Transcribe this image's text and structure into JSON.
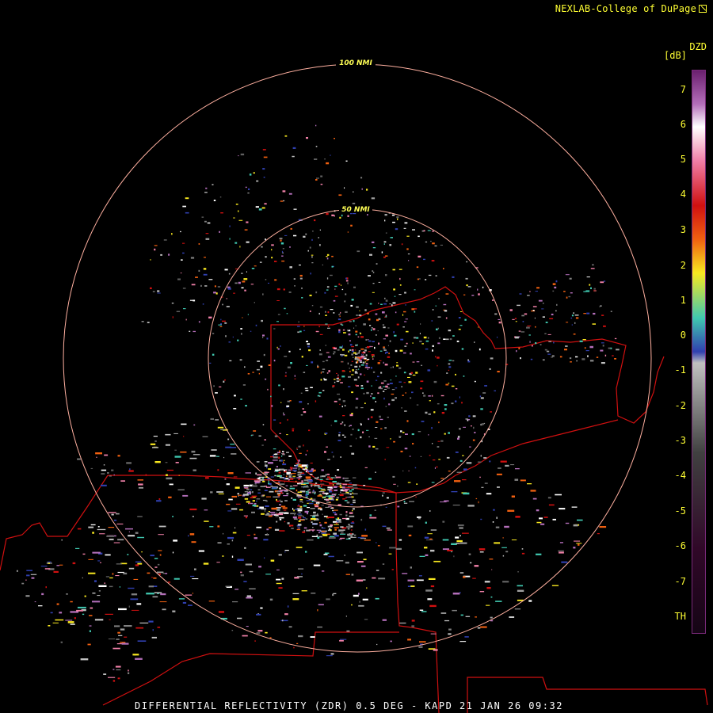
{
  "header": {
    "credit": "NEXLAB-College of DuPage",
    "credit_icon": "external-link-icon"
  },
  "colorbar": {
    "product_code": "DZD",
    "unit": "[dB]",
    "tick_labels": [
      "7",
      "6",
      "5",
      "4",
      "3",
      "2",
      "1",
      "0",
      "-1",
      "-2",
      "-3",
      "-4",
      "-5",
      "-6",
      "-7",
      "TH"
    ],
    "colors": [
      "#6a1f6e",
      "#b46fba",
      "#ffffff",
      "#f080a8",
      "#d01010",
      "#f06010",
      "#f8e820",
      "#40c8b0",
      "#3040b0",
      "#c0c0c0",
      "#404040",
      "#300828"
    ]
  },
  "range_rings": {
    "labels": [
      "100 NMI",
      "50 NMI"
    ],
    "color": "#ffb0a0"
  },
  "map": {
    "border_color": "#d01010"
  },
  "footer": {
    "caption": "DIFFERENTIAL REFLECTIVITY (ZDR) 0.5 DEG - KAPD 21 JAN 26 09:32"
  }
}
